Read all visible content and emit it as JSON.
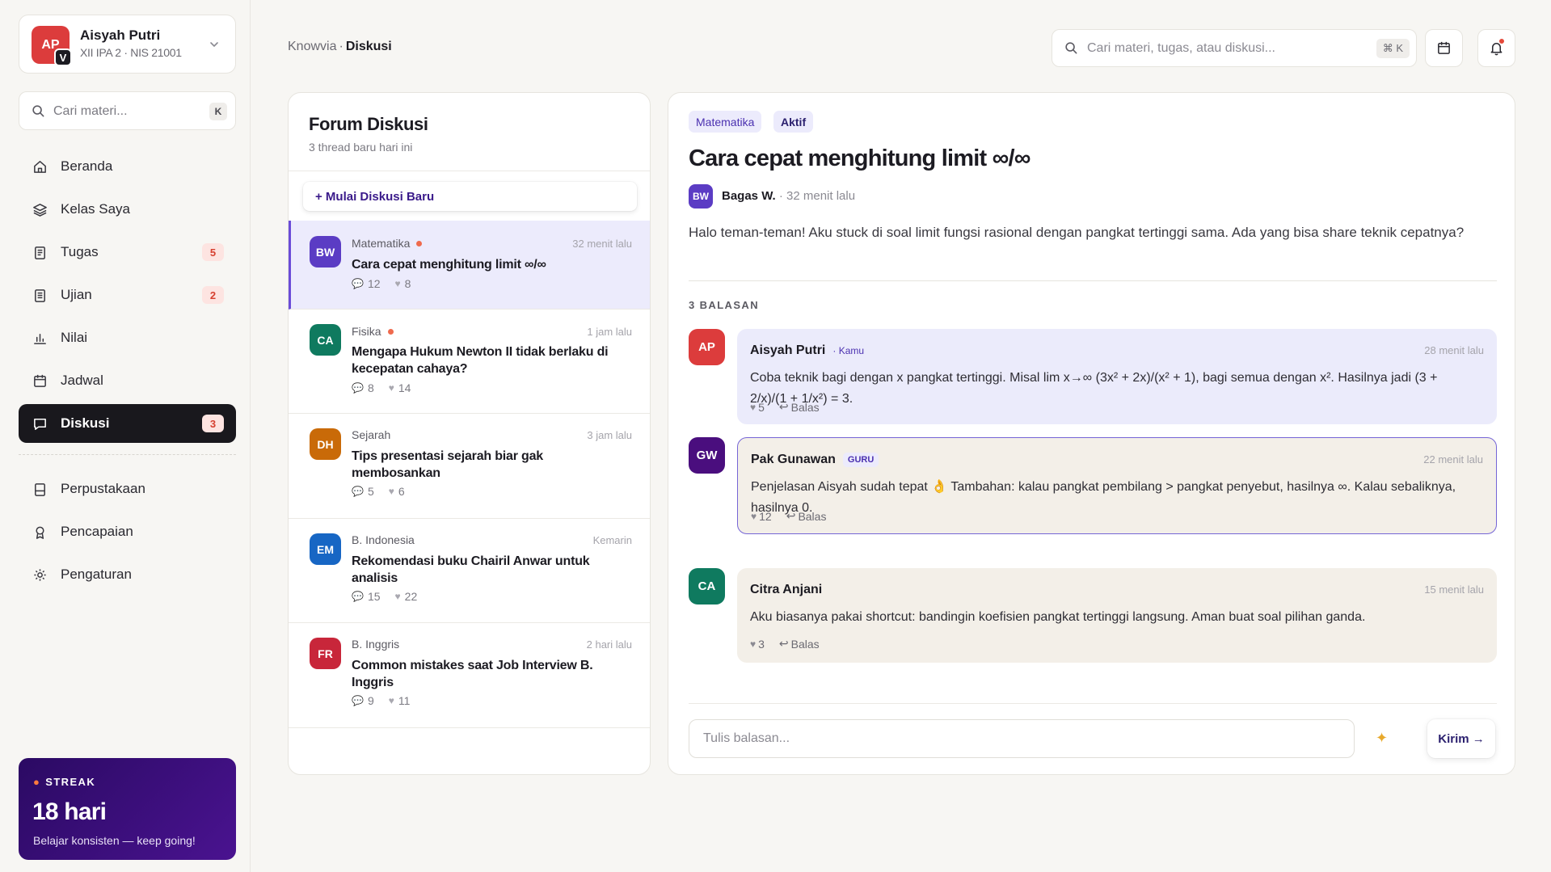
{
  "user": {
    "initials": "AP",
    "badge": "V",
    "name": "Aisyah Putri",
    "class_info": "XII IPA 2 · NIS 21001"
  },
  "sidebar_search": {
    "placeholder": "Cari materi...",
    "shortcut": "K"
  },
  "nav": {
    "items": [
      {
        "label": "Beranda",
        "icon": "home-icon"
      },
      {
        "label": "Kelas Saya",
        "icon": "layers-icon"
      },
      {
        "label": "Tugas",
        "icon": "clipboard-icon",
        "badge": "5"
      },
      {
        "label": "Ujian",
        "icon": "document-icon",
        "badge": "2"
      },
      {
        "label": "Nilai",
        "icon": "bar-chart-icon"
      },
      {
        "label": "Jadwal",
        "icon": "calendar-icon"
      },
      {
        "label": "Diskusi",
        "icon": "chat-icon",
        "badge": "3",
        "active": true
      }
    ],
    "secondary": [
      {
        "label": "Perpustakaan",
        "icon": "library-icon"
      },
      {
        "label": "Pencapaian",
        "icon": "award-icon"
      },
      {
        "label": "Pengaturan",
        "icon": "gear-icon"
      }
    ]
  },
  "streak": {
    "label": "STREAK",
    "value": "18 hari",
    "subtitle": "Belajar konsisten — keep going!"
  },
  "header": {
    "breadcrumb_root": "Knowvia",
    "breadcrumb_sep": "·",
    "breadcrumb_current": "Diskusi",
    "search_placeholder": "Cari materi, tugas, atau diskusi...",
    "search_shortcut": "⌘ K"
  },
  "forum": {
    "title": "Forum Diskusi",
    "subtitle": "3 thread baru hari ini",
    "new_button": "+ Mulai Diskusi Baru",
    "threads": [
      {
        "initials": "BW",
        "color": "#5b3cc4",
        "subject": "Matematika",
        "unread": true,
        "time": "32 menit lalu",
        "title": "Cara cepat menghitung limit ∞/∞",
        "comments": "12",
        "likes": "8",
        "selected": true
      },
      {
        "initials": "CA",
        "color": "#0f7a5f",
        "subject": "Fisika",
        "unread": true,
        "time": "1 jam lalu",
        "title": "Mengapa Hukum Newton II tidak berlaku di kecepatan cahaya?",
        "comments": "8",
        "likes": "14"
      },
      {
        "initials": "DH",
        "color": "#c96a08",
        "subject": "Sejarah",
        "unread": false,
        "time": "3 jam lalu",
        "title": "Tips presentasi sejarah biar gak membosankan",
        "comments": "5",
        "likes": "6"
      },
      {
        "initials": "EM",
        "color": "#1766c4",
        "subject": "B. Indonesia",
        "unread": false,
        "time": "Kemarin",
        "title": "Rekomendasi buku Chairil Anwar untuk analisis",
        "comments": "15",
        "likes": "22"
      },
      {
        "initials": "FR",
        "color": "#c8263a",
        "subject": "B. Inggris",
        "unread": false,
        "time": "2 hari lalu",
        "title": "Common mistakes saat Job Interview B. Inggris",
        "comments": "9",
        "likes": "11"
      }
    ]
  },
  "detail": {
    "subject_tag": "Matematika",
    "status_tag": "Aktif",
    "title": "Cara cepat menghitung limit ∞/∞",
    "author_initials": "BW",
    "author_name": "Bagas W.",
    "author_time": " · 32 menit lalu",
    "body": "Halo teman-teman! Aku stuck di soal limit fungsi rasional dengan pangkat tertinggi sama. Ada yang bisa share teknik cepatnya?",
    "replies_label": "3 BALASAN",
    "replies": [
      {
        "initials": "AP",
        "color": "#dc3c3c",
        "name": "Aisyah Putri",
        "role": "· Kamu",
        "time": "28 menit lalu",
        "text": "Coba teknik bagi dengan x pangkat tertinggi. Misal lim x→∞ (3x² + 2x)/(x² + 1), bagi semua dengan x². Hasilnya jadi (3 + 2/x)/(1 + 1/x²) = 3.",
        "likes": "5",
        "reply_label": "Balas"
      },
      {
        "initials": "GW",
        "color": "#4a0e7e",
        "name": "Pak Gunawan",
        "role": "GURU",
        "time": "22 menit lalu",
        "text": "Penjelasan Aisyah sudah tepat 👌 Tambahan: kalau pangkat pembilang > pangkat penyebut, hasilnya ∞. Kalau sebaliknya, hasilnya 0.",
        "likes": "12",
        "reply_label": "Balas"
      },
      {
        "initials": "CA",
        "color": "#0f7a5f",
        "name": "Citra Anjani",
        "role": "",
        "time": "15 menit lalu",
        "text": "Aku biasanya pakai shortcut: bandingin koefisien pangkat tertinggi langsung. Aman buat soal pilihan ganda.",
        "likes": "3",
        "reply_label": "Balas"
      }
    ],
    "compose_placeholder": "Tulis balasan...",
    "send_label": "Kirim →"
  }
}
